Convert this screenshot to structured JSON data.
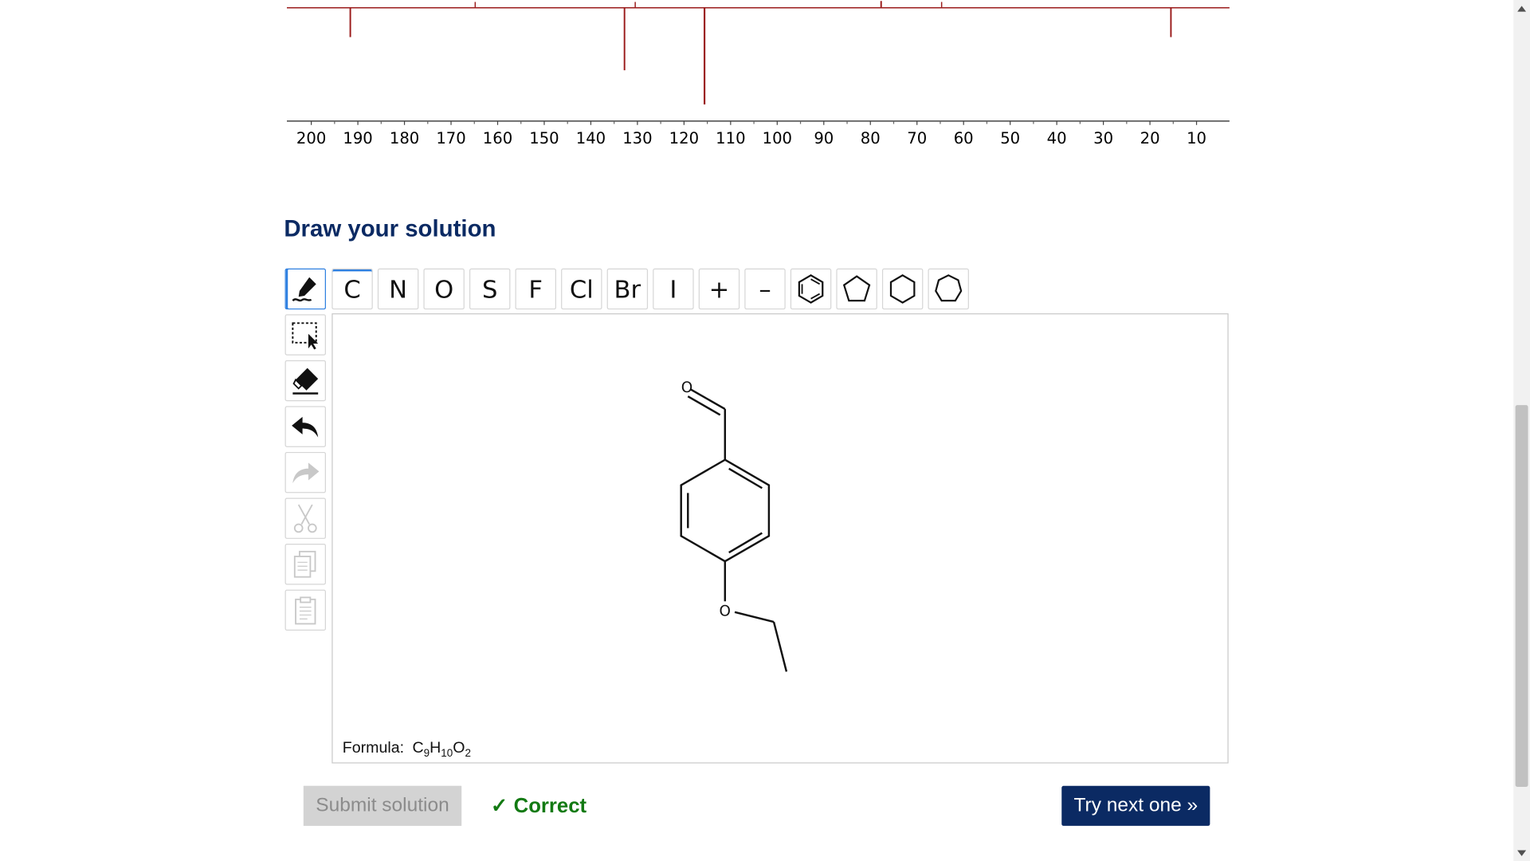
{
  "spectrum": {
    "axis_ticks": [
      "200",
      "190",
      "180",
      "170",
      "160",
      "150",
      "140",
      "130",
      "120",
      "110",
      "100",
      "90",
      "80",
      "70",
      "60",
      "50",
      "40",
      "30",
      "20",
      "10"
    ],
    "line_color": "#9b1c1c"
  },
  "heading": "Draw your solution",
  "toolbar": {
    "atoms": [
      "C",
      "N",
      "O",
      "S",
      "F",
      "Cl",
      "Br",
      "I",
      "+",
      "–"
    ],
    "rings": [
      "benzene-icon",
      "cyclopentane-icon",
      "cyclohexane-icon",
      "cycloheptane-icon"
    ],
    "side_tools": [
      "draw-icon",
      "select-icon",
      "eraser-icon",
      "undo-icon",
      "redo-icon",
      "cut-icon",
      "copy-icon",
      "paste-icon"
    ]
  },
  "molecule": {
    "labels": [
      "O",
      "O"
    ]
  },
  "formula": {
    "label": "Formula:",
    "parts": [
      [
        "C",
        "9"
      ],
      [
        "H",
        "10"
      ],
      [
        "O",
        "2"
      ]
    ]
  },
  "submit_label": "Submit solution",
  "status": {
    "check": "✓",
    "text": "Correct",
    "color": "#137a13"
  },
  "next_label": "Try next one »",
  "colors": {
    "heading": "#0b2a63",
    "accent": "#2d7fe0",
    "next_bg": "#0b2a63"
  }
}
